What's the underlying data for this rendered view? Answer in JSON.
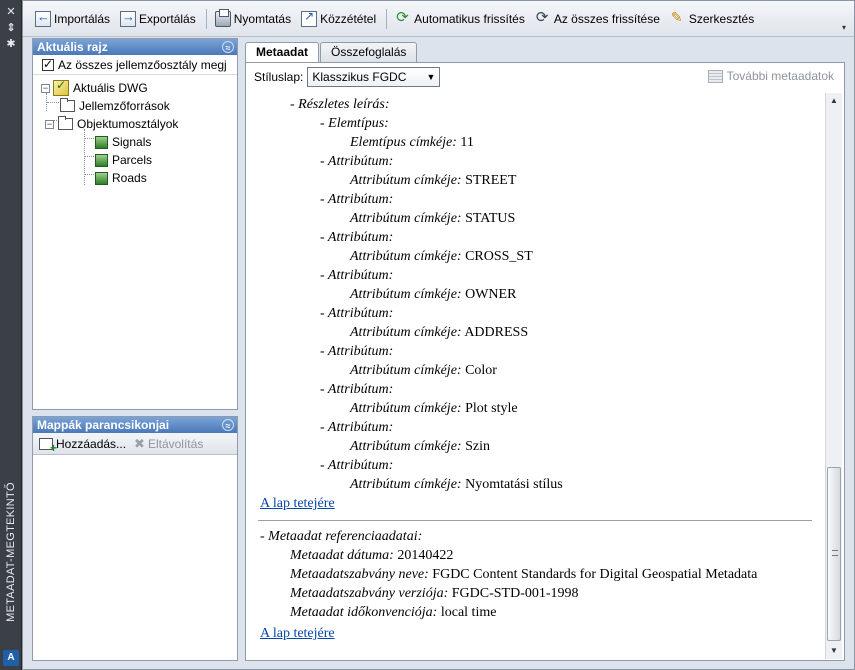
{
  "palette": {
    "title": "METAADAT-MEGTEKINTŐ",
    "close_glyph": "✕",
    "autohide_glyph": "⇕",
    "settings_glyph": "✱",
    "logo_glyph": "A"
  },
  "toolbar": {
    "import": "Importálás",
    "export": "Exportálás",
    "print": "Nyomtatás",
    "publish": "Közzététel",
    "auto_refresh": "Automatikus frissítés",
    "refresh_all": "Az összes frissítése",
    "edit": "Szerkesztés",
    "overflow": "▾"
  },
  "current_drawing": {
    "title": "Aktuális rajz",
    "collapse_glyph": "≈",
    "show_all_label": "Az  összes  jellemzőosztály megj",
    "show_all_checked": true,
    "tree": {
      "root": "Aktuális DWG",
      "feature_sources": "Jellemzőforrások",
      "object_classes": "Objektumosztályok",
      "layers": [
        "Signals",
        "Parcels",
        "Roads"
      ]
    }
  },
  "folder_shortcuts": {
    "title": "Mappák parancsikonjai",
    "add": "Hozzáadás...",
    "remove": "Eltávolítás"
  },
  "tabs": {
    "metadata": "Metaadat",
    "summary": "Összefoglalás",
    "active": "metadata"
  },
  "options": {
    "stylesheet_label": "Stíluslap:",
    "stylesheet_value": "Klasszikus FGDC",
    "more_metadata": "További metaadatok"
  },
  "document": {
    "detailed_description": "- Részletes leírás:",
    "entity_type": "- Elemtípus:",
    "entity_type_label_key": "Elemtípus címkéje:",
    "entity_type_label_value": "11",
    "attribute_heading": "- Attribútum:",
    "attribute_label_key": "Attribútum címkéje:",
    "attributes": [
      "STREET",
      "STATUS",
      "CROSS_ST",
      "OWNER",
      "ADDRESS",
      "Color",
      "Plot style",
      "Szin",
      "Nyomtatási stílus"
    ],
    "top_link": "A lap tetejére",
    "reference_heading": "- Metaadat referenciaadatai:",
    "reference": [
      {
        "key": "Metaadat dátuma:",
        "value": "20140422"
      },
      {
        "key": "Metaadatszabvány neve:",
        "value": "FGDC Content Standards for Digital Geospatial Metadata"
      },
      {
        "key": "Metaadatszabvány verziója:",
        "value": "FGDC-STD-001-1998"
      },
      {
        "key": "Metaadat időkonvenciója:",
        "value": "local time"
      }
    ]
  },
  "scrollbar": {
    "up_glyph": "▲",
    "down_glyph": "▼"
  }
}
